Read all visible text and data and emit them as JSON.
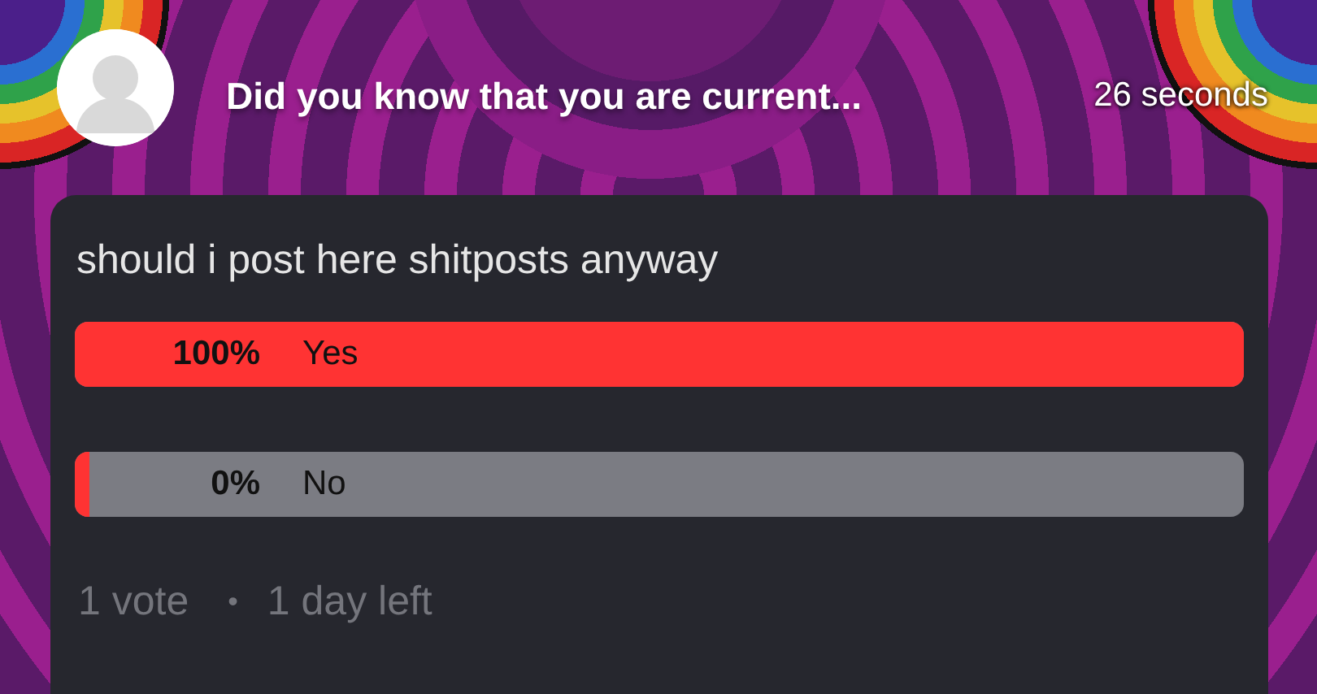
{
  "post": {
    "title": "Did you know that you are current...",
    "time": "26 seconds"
  },
  "poll": {
    "question": "should i post here shitposts anyway",
    "options": [
      {
        "percent": "100%",
        "label": "Yes",
        "level": 1
      },
      {
        "percent": "0%",
        "label": "No",
        "level": 0
      }
    ],
    "votes": "1 vote",
    "separator": "•",
    "time_left": "1 day left"
  }
}
